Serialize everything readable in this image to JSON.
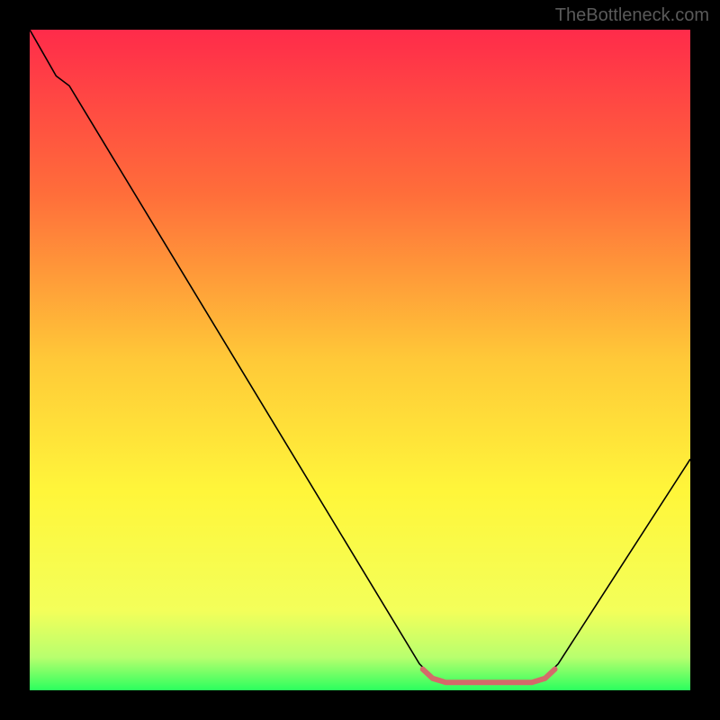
{
  "watermark": "TheBottleneck.com",
  "chart_data": {
    "type": "line",
    "title": "",
    "xlabel": "",
    "ylabel": "",
    "xlim": [
      0,
      100
    ],
    "ylim": [
      0,
      100
    ],
    "gradient_stops": [
      {
        "offset": 0,
        "color": "#ff2b4a"
      },
      {
        "offset": 25,
        "color": "#ff6e3a"
      },
      {
        "offset": 50,
        "color": "#ffc938"
      },
      {
        "offset": 70,
        "color": "#fff63a"
      },
      {
        "offset": 88,
        "color": "#f3ff5a"
      },
      {
        "offset": 95,
        "color": "#b8ff6e"
      },
      {
        "offset": 100,
        "color": "#2bff5e"
      }
    ],
    "series": [
      {
        "name": "bottleneck-curve",
        "color": "#000000",
        "points": [
          {
            "x": 0,
            "y": 100
          },
          {
            "x": 4,
            "y": 93
          },
          {
            "x": 6,
            "y": 91.5
          },
          {
            "x": 59,
            "y": 4
          },
          {
            "x": 61,
            "y": 2
          },
          {
            "x": 63,
            "y": 1
          },
          {
            "x": 76,
            "y": 1
          },
          {
            "x": 78,
            "y": 2
          },
          {
            "x": 80,
            "y": 4
          },
          {
            "x": 100,
            "y": 35
          }
        ]
      },
      {
        "name": "optimal-band",
        "color": "#d46a6a",
        "stroke_width": 6,
        "points": [
          {
            "x": 59.5,
            "y": 3.2
          },
          {
            "x": 61,
            "y": 1.8
          },
          {
            "x": 63,
            "y": 1.2
          },
          {
            "x": 76,
            "y": 1.2
          },
          {
            "x": 78,
            "y": 1.8
          },
          {
            "x": 79.5,
            "y": 3.2
          }
        ]
      }
    ]
  }
}
